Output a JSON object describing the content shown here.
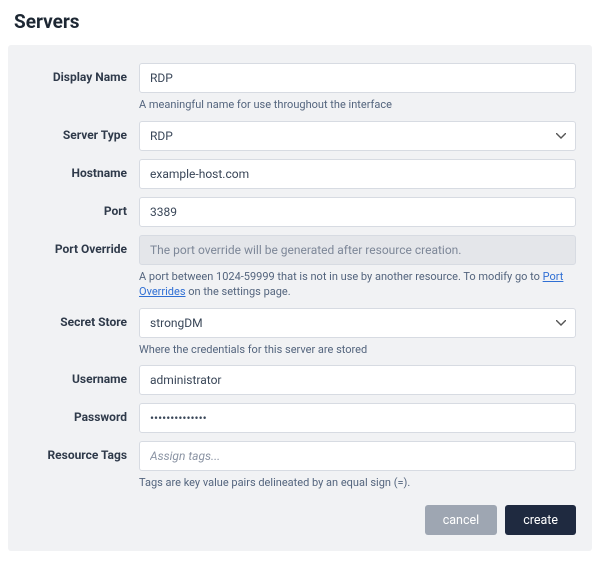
{
  "page": {
    "title": "Servers"
  },
  "fields": {
    "display_name": {
      "label": "Display Name",
      "value": "RDP",
      "help": "A meaningful name for use throughout the interface"
    },
    "server_type": {
      "label": "Server Type",
      "value": "RDP"
    },
    "hostname": {
      "label": "Hostname",
      "value": "example-host.com"
    },
    "port": {
      "label": "Port",
      "value": "3389"
    },
    "port_override": {
      "label": "Port Override",
      "placeholder": "The port override will be generated after resource creation.",
      "help_prefix": "A port between 1024-59999 that is not in use by another resource. To modify go to ",
      "help_link": "Port Overrides",
      "help_suffix": " on the settings page."
    },
    "secret_store": {
      "label": "Secret Store",
      "value": "strongDM",
      "help": "Where the credentials for this server are stored"
    },
    "username": {
      "label": "Username",
      "value": "administrator"
    },
    "password": {
      "label": "Password",
      "value": "••••••••••••••"
    },
    "resource_tags": {
      "label": "Resource Tags",
      "placeholder": "Assign tags...",
      "help": "Tags are key value pairs delineated by an equal sign (=)."
    }
  },
  "buttons": {
    "cancel": "cancel",
    "create": "create"
  }
}
